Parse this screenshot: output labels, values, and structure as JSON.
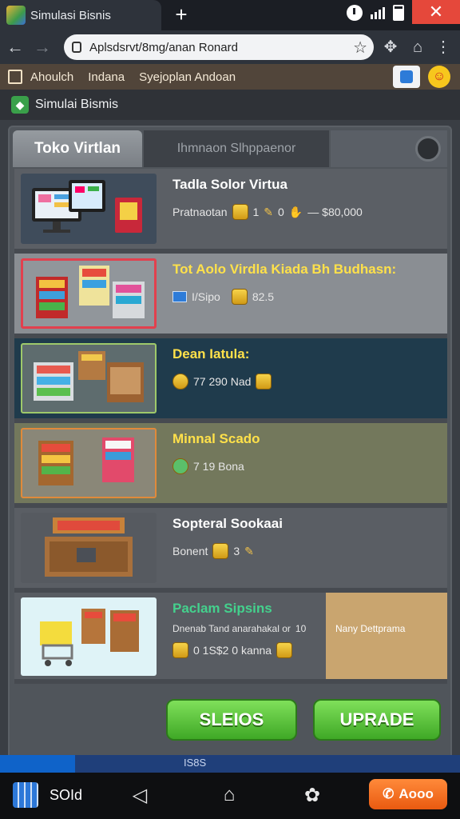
{
  "browser": {
    "tab_title": "Simulasi Bisnis",
    "new_tab": "+",
    "url": "Aplsdsrvt/8mg/anan Ronard",
    "close": "✕"
  },
  "bookmarks": {
    "items": [
      "Ahoulch",
      "Indana",
      "Syejoplan Andoan"
    ]
  },
  "app": {
    "title": "Simulai Bismis",
    "tabs": {
      "active": "Toko Virtlan",
      "inactive": "Ihmnaon Slhppaenor"
    },
    "items": [
      {
        "name": "Tadla Solor Virtua",
        "meta1": "Pratnaotan",
        "meta2": "1",
        "meta3": "0",
        "price": "— $80,000"
      },
      {
        "name": "Tot Aolo Virdla Kiada Bh Budhasn:",
        "meta1": "I/Sipo",
        "meta2": "",
        "meta3": "",
        "price": "82.5"
      },
      {
        "name": "Dean Iatula:",
        "meta1": "",
        "meta2": "",
        "meta3": "",
        "price": "77 290 Nad"
      },
      {
        "name": "Minnal Scado",
        "meta1": "",
        "meta2": "",
        "meta3": "",
        "price": "7 19 Bona"
      },
      {
        "name": "Sopteral Sookaai",
        "meta1": "Bonent",
        "meta2": "3",
        "meta3": "",
        "price": ""
      },
      {
        "name": "Paclam Sipsins",
        "meta1": "Dnenab Tand anarahakal or",
        "meta2": "10",
        "meta3": "",
        "price": "0 1S$2 0 kanna",
        "side_text": "Nany Dettprama"
      }
    ],
    "buttons": {
      "primary": "SLEIOS",
      "secondary": "UPRADE"
    }
  },
  "taskbar": {
    "label": "IS8S"
  },
  "system": {
    "label": "SOId",
    "action": "Aooo"
  }
}
